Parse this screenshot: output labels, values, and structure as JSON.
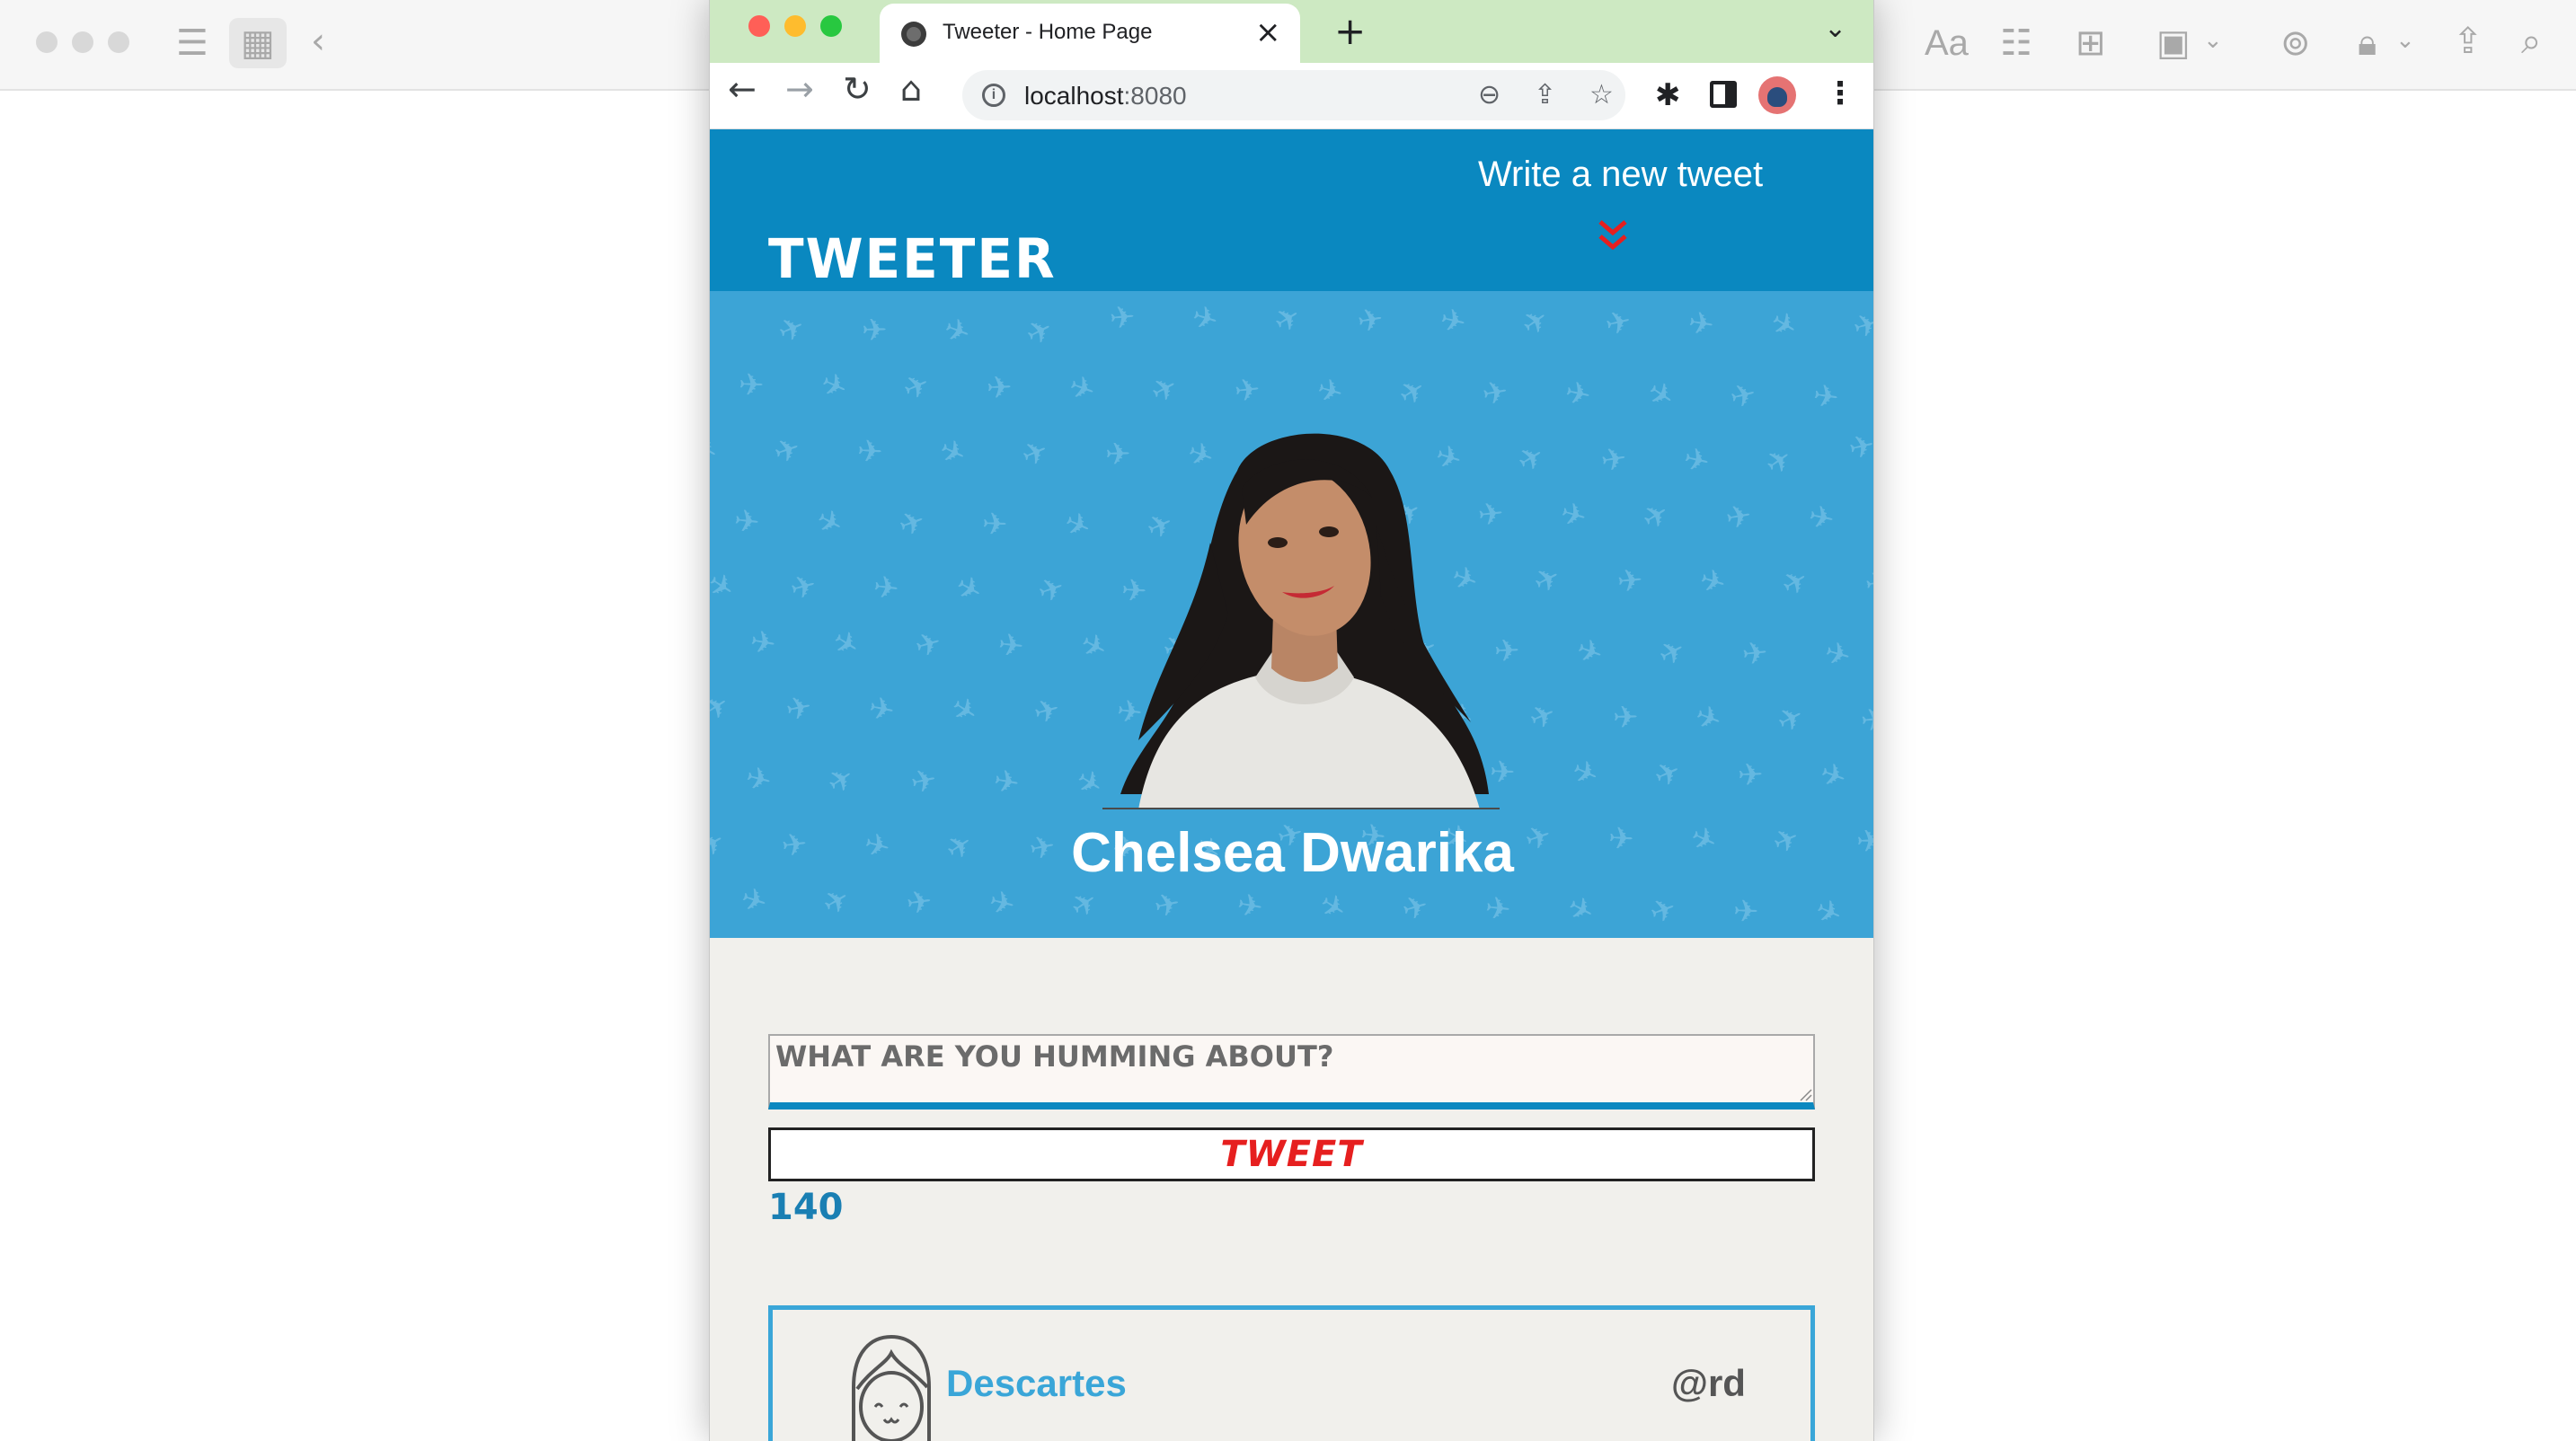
{
  "browser": {
    "tab_title": "Tweeter - Home Page",
    "url_host": "localhost",
    "url_port": ":8080"
  },
  "site": {
    "logo": "Tweeter",
    "compose_toggle_label": "Write a new tweet",
    "profile_name": "Chelsea Dwarika",
    "compose_placeholder": "What are you humming about?",
    "tweet_button_label": "Tweet",
    "char_counter": "140",
    "tweets": [
      {
        "name": "Descartes",
        "handle": "@rd"
      }
    ]
  },
  "colors": {
    "nav_blue": "#0a88c0",
    "hero_blue": "#3ca4d6",
    "accent_red": "#e61f1f",
    "page_bg": "#f1f0ec",
    "tab_strip_green": "#cde9c2"
  }
}
